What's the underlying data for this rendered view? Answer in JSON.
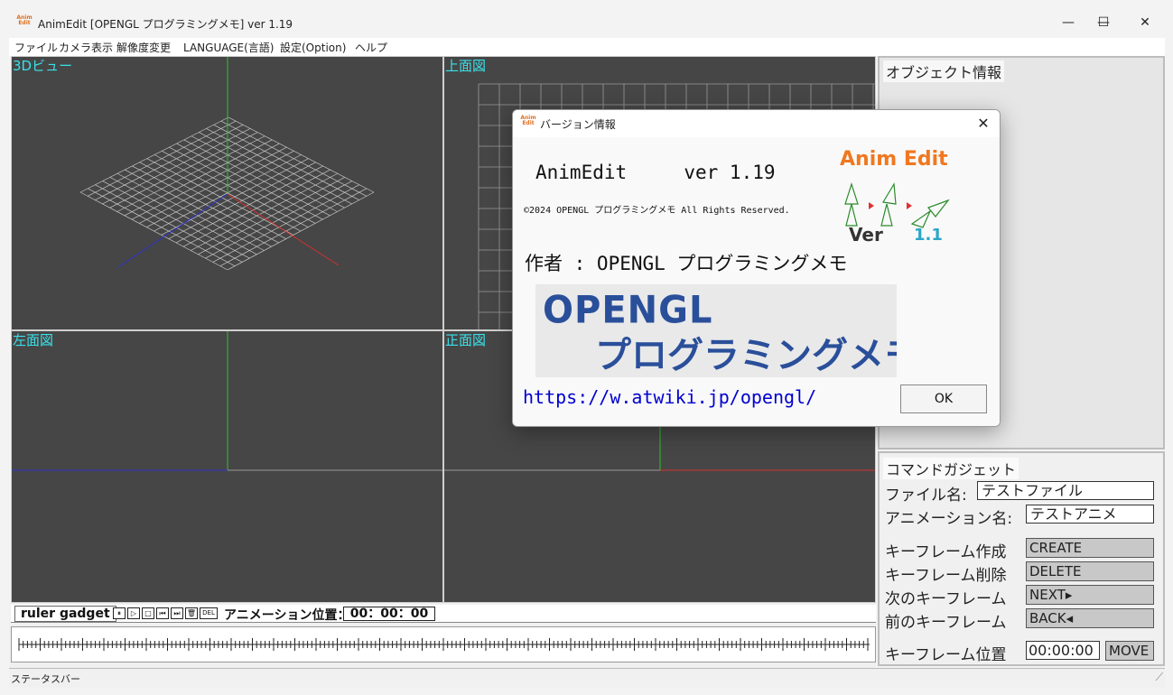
{
  "window": {
    "title": "AnimEdit [OPENGL プログラミングメモ] ver 1.19",
    "icon_text": "Anim Edit",
    "minimize": "—",
    "maximize": "☐",
    "close": "✕"
  },
  "menu": [
    "ファイル",
    "カメラ表示",
    "解像度変更",
    "LANGUAGE(言語)",
    "設定(Option)",
    "ヘルプ"
  ],
  "viewports": {
    "v3d": "3Dビュー",
    "top": "上面図",
    "left": "左面図",
    "front": "正面図"
  },
  "object_panel": {
    "title": "オブジェクト情報"
  },
  "command_gadget": {
    "title": "コマンドガジェット",
    "file_name_label": "ファイル名:",
    "file_name_value": "テストファイル",
    "anim_name_label": "アニメーション名:",
    "anim_name_value": "テストアニメ",
    "create_label": "キーフレーム作成",
    "create_btn": "CREATE",
    "delete_label": "キーフレーム削除",
    "delete_btn": "DELETE",
    "next_label": "次のキーフレーム",
    "next_btn": "NEXT▸",
    "back_label": "前のキーフレーム",
    "back_btn": "BACK◂",
    "pos_label": "キーフレーム位置",
    "pos_value": "00:00:00",
    "move_btn": "MOVE"
  },
  "ruler": {
    "label": "ruler gadget",
    "icons": [
      "⏸",
      "▷",
      "□",
      "⏮",
      "⏭",
      "🗑",
      "DEL"
    ],
    "anim_pos_label": "アニメーション位置：",
    "anim_pos_value": "00：00：00"
  },
  "statusbar": {
    "text": "ステータスバー"
  },
  "dialog": {
    "title": "バージョン情報",
    "close": "✕",
    "app_name": "AnimEdit     ver 1.19",
    "copyright": "©2024 OPENGL プログラミングメモ All Rights Reserved.",
    "author": "作者 : OPENGL プログラミングメモ",
    "banner_line1": "OPENGL",
    "banner_line2": "プログラミングメモ",
    "url": "https://w.atwiki.jp/opengl/",
    "ok": "OK",
    "logo_title": "Anim Edit",
    "logo_ver": "Ver",
    "logo_num": "1.1"
  },
  "colors": {
    "viewport_bg": "#464646",
    "viewport_label": "#39e0e8",
    "grid": "#c8c8c8",
    "axis_x": "#d03030",
    "axis_y": "#30c030",
    "axis_z": "#3030d0",
    "logo_orange": "#f07820",
    "url_blue": "#0000d0"
  }
}
